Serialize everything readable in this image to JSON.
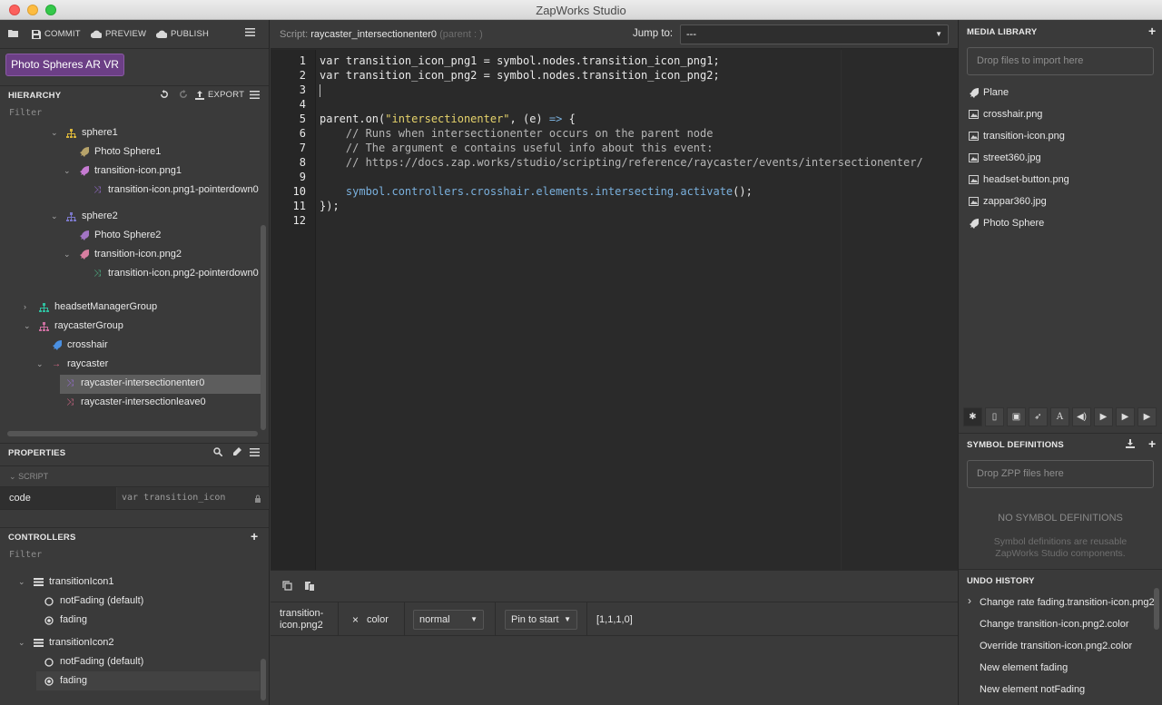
{
  "window": {
    "title": "ZapWorks Studio"
  },
  "toolbar": {
    "commit": "COMMIT",
    "preview": "PREVIEW",
    "publish": "PUBLISH"
  },
  "project": {
    "name": "Photo Spheres AR VR"
  },
  "hierarchy": {
    "title": "HIERARCHY",
    "export": "EXPORT",
    "filter": "Filter",
    "nodes": [
      "sphere1",
      "Photo Sphere1",
      "transition-icon.png1",
      "transition-icon.png1-pointerdown0",
      "sphere2",
      "Photo Sphere2",
      "transition-icon.png2",
      "transition-icon.png2-pointerdown0",
      "headsetManagerGroup",
      "raycasterGroup",
      "crosshair",
      "raycaster",
      "raycaster-intersectionenter0",
      "raycaster-intersectionleave0"
    ]
  },
  "properties": {
    "title": "PROPERTIES",
    "section": "SCRIPT",
    "key": "code",
    "value": "var transition_icon"
  },
  "controllers": {
    "title": "CONTROLLERS",
    "filter": "Filter",
    "items": [
      "transitionIcon1",
      "notFading (default)",
      "fading",
      "transitionIcon2",
      "notFading (default)",
      "fading"
    ]
  },
  "script": {
    "label_prefix": "Script:",
    "name": "raycaster_intersectionenter0",
    "parent_hint": "(parent : )",
    "jump_label": "Jump to:",
    "jump_value": "---"
  },
  "code_lines": {
    "l1a": "var transition_icon_png1 = symbol.nodes.transition_icon_png1;",
    "l2a": "var transition_icon_png2 = symbol.nodes.transition_icon_png2;",
    "l5a": "parent.on(",
    "l5b": "\"intersectionenter\"",
    "l5c": ", (e) ",
    "l5d": "=>",
    "l5e": " {",
    "l6": "    // Runs when intersectionenter occurs on the parent node",
    "l7": "    // The argument e contains useful info about this event:",
    "l8": "    // https://docs.zap.works/studio/scripting/reference/raycaster/events/intersectionenter/",
    "l10a": "    symbol.controllers.crosshair.elements.intersecting.activate",
    "l10b": "();",
    "l11": "});"
  },
  "line_numbers": [
    "1",
    "2",
    "3",
    "4",
    "5",
    "6",
    "7",
    "8",
    "9",
    "10",
    "11",
    "12"
  ],
  "timeline": {
    "node": "transition-icon.png2",
    "property": "color",
    "blend": "normal",
    "pin": "Pin to start",
    "value": "[1,1,1,0]"
  },
  "media_library": {
    "title": "MEDIA LIBRARY",
    "dropzone": "Drop files to import here",
    "items": [
      "Plane",
      "crosshair.png",
      "transition-icon.png",
      "street360.jpg",
      "headset-button.png",
      "zappar360.jpg",
      "Photo Sphere"
    ]
  },
  "symbol_definitions": {
    "title": "SYMBOL DEFINITIONS",
    "dropzone": "Drop ZPP files here",
    "empty_title": "NO SYMBOL DEFINITIONS",
    "empty_desc_1": "Symbol definitions are reusable",
    "empty_desc_2": "ZapWorks Studio components."
  },
  "undo_history": {
    "title": "UNDO HISTORY",
    "items": [
      "Change rate fading.transition-icon.png2",
      "Change transition-icon.png2.color",
      "Override transition-icon.png2.color",
      "New element fading",
      "New element notFading"
    ]
  },
  "colors": {
    "accent_purple": "#6c3f86",
    "group_icon_yellow": "#d8b43a",
    "plane_icon_purple": "#a274c4",
    "pointer_icon_purple": "#9a6fd6",
    "pointer_icon_green": "#4fb98a",
    "group_icon_teal": "#2fbf9f",
    "group_icon_pink": "#cc6fa0",
    "crosshair_blue": "#4a90e2",
    "raycaster_pink": "#d86a8a"
  }
}
